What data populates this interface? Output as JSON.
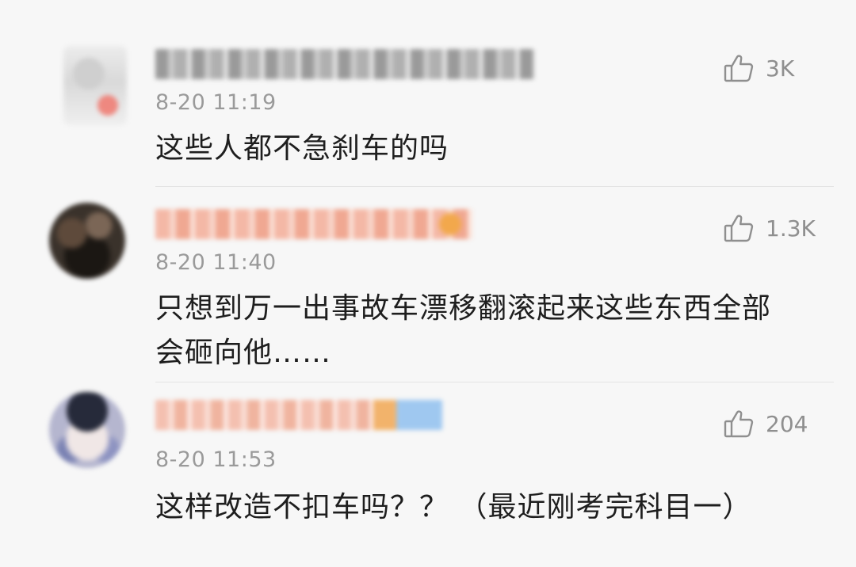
{
  "comments": [
    {
      "timestamp": "8-20 11:19",
      "likes": "3K",
      "text": "这些人都不急刹车的吗"
    },
    {
      "timestamp": "8-20 11:40",
      "likes": "1.3K",
      "text": "只想到万一出事故车漂移翻滚起来这些东西全部会砸向他……"
    },
    {
      "timestamp": "8-20 11:53",
      "likes": "204",
      "text": "这样改造不扣车吗？？ （最近刚考完科目一）"
    }
  ]
}
